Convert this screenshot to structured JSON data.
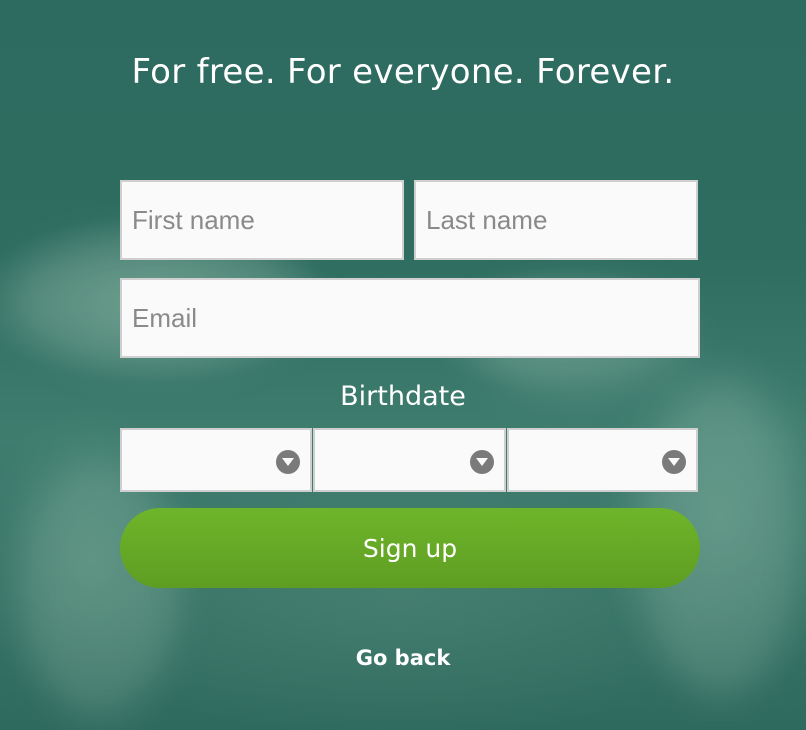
{
  "header": {
    "headline": "For free. For everyone. Forever."
  },
  "form": {
    "first_name": {
      "value": "",
      "placeholder": "First name"
    },
    "last_name": {
      "value": "",
      "placeholder": "Last name"
    },
    "email": {
      "value": "",
      "placeholder": "Email"
    },
    "birthdate_label": "Birthdate",
    "birthdate_selects": [
      {
        "selected": ""
      },
      {
        "selected": ""
      },
      {
        "selected": ""
      }
    ],
    "signup_label": "Sign up",
    "go_back_label": "Go back"
  },
  "colors": {
    "background": "#2f6a5e",
    "button_green": "#6fb52a",
    "text_white": "#ffffff"
  }
}
